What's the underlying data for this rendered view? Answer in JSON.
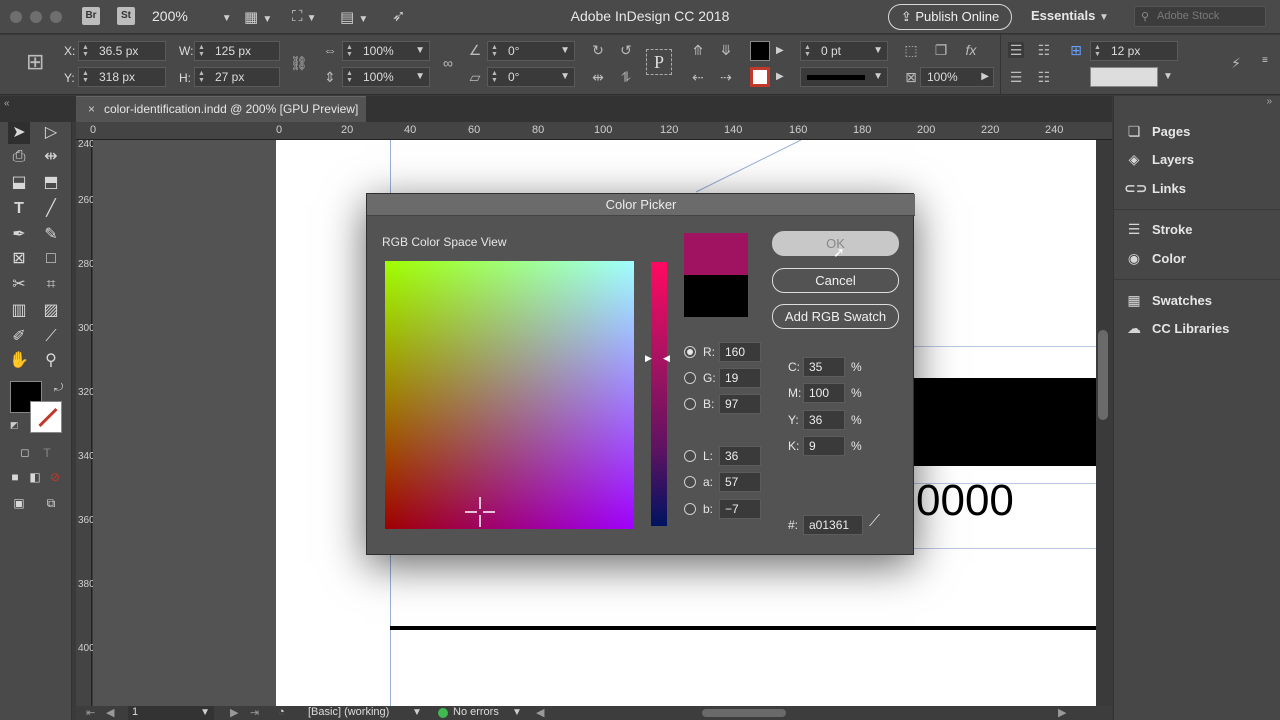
{
  "appbar": {
    "apps": [
      "Br",
      "St"
    ],
    "zoom": "200%",
    "title": "Adobe InDesign CC 2018",
    "publish_label": "Publish Online",
    "workspace": "Essentials",
    "search_placeholder": "Adobe Stock"
  },
  "control": {
    "x_label": "X:",
    "x_value": "36.5 px",
    "y_label": "Y:",
    "y_value": "318 px",
    "w_label": "W:",
    "w_value": "125 px",
    "h_label": "H:",
    "h_value": "27 px",
    "scale_x": "100%",
    "scale_y": "100%",
    "rotate": "0°",
    "shear": "0°",
    "stroke_weight": "0 pt",
    "opacity": "100%",
    "spacing": "12 px"
  },
  "document_tab": {
    "title": "color-identification.indd @ 200% [GPU Preview]"
  },
  "ruler": {
    "h_ticks": [
      "0",
      "0",
      "20",
      "40",
      "60",
      "80",
      "100",
      "120",
      "140",
      "160",
      "180",
      "200",
      "220",
      "240"
    ],
    "v_ticks": [
      "240",
      "260",
      "280",
      "300",
      "320",
      "340",
      "360",
      "380",
      "400"
    ]
  },
  "page": {
    "visible_text": "0000"
  },
  "panels": [
    {
      "icon": "pages-icon",
      "label": "Pages"
    },
    {
      "icon": "layers-icon",
      "label": "Layers"
    },
    {
      "icon": "links-icon",
      "label": "Links"
    },
    {
      "icon": "stroke-icon",
      "label": "Stroke"
    },
    {
      "icon": "color-icon",
      "label": "Color"
    },
    {
      "icon": "swatches-icon",
      "label": "Swatches"
    },
    {
      "icon": "cc-libraries-icon",
      "label": "CC Libraries"
    }
  ],
  "status": {
    "page": "1",
    "profile": "[Basic] (working)",
    "errors": "No errors"
  },
  "dialog": {
    "title": "Color Picker",
    "view_label": "RGB Color Space View",
    "ok_label": "OK",
    "cancel_label": "Cancel",
    "add_swatch_label": "Add RGB Swatch",
    "rgb": [
      {
        "label": "R:",
        "value": "160",
        "selected": true
      },
      {
        "label": "G:",
        "value": "19",
        "selected": false
      },
      {
        "label": "B:",
        "value": "97",
        "selected": false
      }
    ],
    "lab": [
      {
        "label": "L:",
        "value": "36"
      },
      {
        "label": "a:",
        "value": "57"
      },
      {
        "label": "b:",
        "value": "−7"
      }
    ],
    "cmyk": [
      {
        "label": "C:",
        "value": "35",
        "unit": "%"
      },
      {
        "label": "M:",
        "value": "100",
        "unit": "%"
      },
      {
        "label": "Y:",
        "value": "36",
        "unit": "%"
      },
      {
        "label": "K:",
        "value": "9",
        "unit": "%"
      }
    ],
    "hex_label": "#:",
    "hex_value": "a01361",
    "new_color": "#a01361",
    "old_color": "#000000"
  }
}
